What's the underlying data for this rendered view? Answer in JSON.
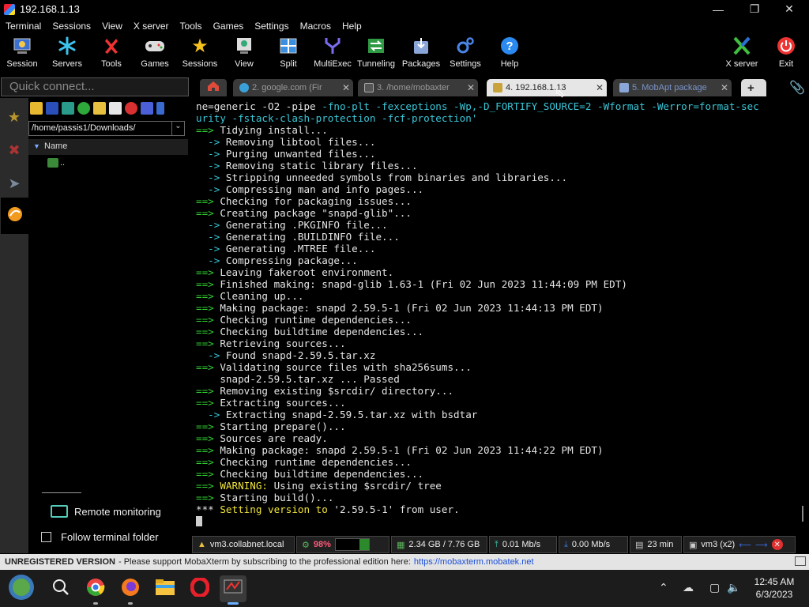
{
  "window": {
    "title": "192.168.1.13"
  },
  "menu": [
    "Terminal",
    "Sessions",
    "View",
    "X server",
    "Tools",
    "Games",
    "Settings",
    "Macros",
    "Help"
  ],
  "toolbar": {
    "session": "Session",
    "servers": "Servers",
    "tools": "Tools",
    "games": "Games",
    "sessions": "Sessions",
    "view": "View",
    "split": "Split",
    "multiexec": "MultiExec",
    "tunneling": "Tunneling",
    "packages": "Packages",
    "settings": "Settings",
    "help": "Help",
    "xserver": "X server",
    "exit": "Exit"
  },
  "quick_connect": {
    "placeholder": "Quick connect..."
  },
  "tabs": [
    {
      "label": "2. google.com (Fir",
      "active": false
    },
    {
      "label": "3. /home/mobaxter",
      "active": false
    },
    {
      "label": "4. 192.168.1.13",
      "active": true
    },
    {
      "label": "5. MobApt package",
      "active": false
    }
  ],
  "files": {
    "path": "/home/passis1/Downloads/",
    "column": "Name",
    "rows": [
      ".."
    ],
    "remote_monitoring": "Remote monitoring",
    "follow_folder": "Follow terminal folder"
  },
  "terminal": {
    "lines": [
      {
        "segs": [
          [
            "ne=generic -O2 -pipe ",
            "w"
          ],
          [
            "-fno-plt -fexceptions -Wp,-D_FORTIFY_SOURCE=2 -Wformat -Werror=format-sec",
            "c"
          ]
        ]
      },
      {
        "segs": [
          [
            "urity -fstack-clash-protection -fcf-protection'",
            "c"
          ]
        ]
      },
      {
        "segs": [
          [
            "==> ",
            "g"
          ],
          [
            "Tidying install...",
            "w"
          ]
        ]
      },
      {
        "segs": [
          [
            "  -> ",
            "c"
          ],
          [
            "Removing libtool files...",
            "w"
          ]
        ]
      },
      {
        "segs": [
          [
            "  -> ",
            "c"
          ],
          [
            "Purging unwanted files...",
            "w"
          ]
        ]
      },
      {
        "segs": [
          [
            "  -> ",
            "c"
          ],
          [
            "Removing static library files...",
            "w"
          ]
        ]
      },
      {
        "segs": [
          [
            "  -> ",
            "c"
          ],
          [
            "Stripping unneeded symbols from binaries and libraries...",
            "w"
          ]
        ]
      },
      {
        "segs": [
          [
            "  -> ",
            "c"
          ],
          [
            "Compressing man and info pages...",
            "w"
          ]
        ]
      },
      {
        "segs": [
          [
            "==> ",
            "g"
          ],
          [
            "Checking for packaging issues...",
            "w"
          ]
        ]
      },
      {
        "segs": [
          [
            "==> ",
            "g"
          ],
          [
            "Creating package \"snapd-glib\"...",
            "w"
          ]
        ]
      },
      {
        "segs": [
          [
            "  -> ",
            "c"
          ],
          [
            "Generating .PKGINFO file...",
            "w"
          ]
        ]
      },
      {
        "segs": [
          [
            "  -> ",
            "c"
          ],
          [
            "Generating .BUILDINFO file...",
            "w"
          ]
        ]
      },
      {
        "segs": [
          [
            "  -> ",
            "c"
          ],
          [
            "Generating .MTREE file...",
            "w"
          ]
        ]
      },
      {
        "segs": [
          [
            "  -> ",
            "c"
          ],
          [
            "Compressing package...",
            "w"
          ]
        ]
      },
      {
        "segs": [
          [
            "==> ",
            "g"
          ],
          [
            "Leaving fakeroot environment.",
            "w"
          ]
        ]
      },
      {
        "segs": [
          [
            "==> ",
            "g"
          ],
          [
            "Finished making: snapd-glib 1.63-1 (Fri 02 Jun 2023 11:44:09 PM EDT)",
            "w"
          ]
        ]
      },
      {
        "segs": [
          [
            "==> ",
            "g"
          ],
          [
            "Cleaning up...",
            "w"
          ]
        ]
      },
      {
        "segs": [
          [
            "==> ",
            "g"
          ],
          [
            "Making package: snapd 2.59.5-1 (Fri 02 Jun 2023 11:44:13 PM EDT)",
            "w"
          ]
        ]
      },
      {
        "segs": [
          [
            "==> ",
            "g"
          ],
          [
            "Checking runtime dependencies...",
            "w"
          ]
        ]
      },
      {
        "segs": [
          [
            "==> ",
            "g"
          ],
          [
            "Checking buildtime dependencies...",
            "w"
          ]
        ]
      },
      {
        "segs": [
          [
            "==> ",
            "g"
          ],
          [
            "Retrieving sources...",
            "w"
          ]
        ]
      },
      {
        "segs": [
          [
            "  -> ",
            "c"
          ],
          [
            "Found snapd-2.59.5.tar.xz",
            "w"
          ]
        ]
      },
      {
        "segs": [
          [
            "==> ",
            "g"
          ],
          [
            "Validating source files with sha256sums...",
            "w"
          ]
        ]
      },
      {
        "segs": [
          [
            "    snapd-2.59.5.tar.xz ... Passed",
            "w"
          ]
        ]
      },
      {
        "segs": [
          [
            "==> ",
            "g"
          ],
          [
            "Removing existing $srcdir/ directory...",
            "w"
          ]
        ]
      },
      {
        "segs": [
          [
            "==> ",
            "g"
          ],
          [
            "Extracting sources...",
            "w"
          ]
        ]
      },
      {
        "segs": [
          [
            "  -> ",
            "c"
          ],
          [
            "Extracting snapd-2.59.5.tar.xz with bsdtar",
            "w"
          ]
        ]
      },
      {
        "segs": [
          [
            "==> ",
            "g"
          ],
          [
            "Starting prepare()...",
            "w"
          ]
        ]
      },
      {
        "segs": [
          [
            "==> ",
            "g"
          ],
          [
            "Sources are ready.",
            "w"
          ]
        ]
      },
      {
        "segs": [
          [
            "==> ",
            "g"
          ],
          [
            "Making package: snapd 2.59.5-1 (Fri 02 Jun 2023 11:44:22 PM EDT)",
            "w"
          ]
        ]
      },
      {
        "segs": [
          [
            "==> ",
            "g"
          ],
          [
            "Checking runtime dependencies...",
            "w"
          ]
        ]
      },
      {
        "segs": [
          [
            "==> ",
            "g"
          ],
          [
            "Checking buildtime dependencies...",
            "w"
          ]
        ]
      },
      {
        "segs": [
          [
            "==> ",
            "g"
          ],
          [
            "WARNING: ",
            "y"
          ],
          [
            "Using existing $srcdir/ tree",
            "w"
          ]
        ]
      },
      {
        "segs": [
          [
            "==> ",
            "g"
          ],
          [
            "Starting build()...",
            "w"
          ]
        ]
      },
      {
        "segs": [
          [
            "*** ",
            "w"
          ],
          [
            "Setting version to ",
            "y"
          ],
          [
            "'2.59.5-1'",
            "w"
          ],
          [
            " from user.",
            "w"
          ]
        ]
      }
    ]
  },
  "statusbar": {
    "host": "vm3.collabnet.local",
    "cpu": "98%",
    "memory": "2.34 GB / 7.76 GB",
    "upload": "0.01 Mb/s",
    "download": "0.00 Mb/s",
    "uptime": "23 min",
    "user": "vm3 (x2)"
  },
  "unregistered": {
    "label": "UNREGISTERED VERSION",
    "message": "-  Please support MobaXterm by subscribing to the professional edition here:",
    "link": "https://mobaxterm.mobatek.net"
  },
  "taskbar": {
    "time": "12:45 AM",
    "date": "6/3/2023"
  },
  "colors": {
    "green": "#33d133",
    "cyan": "#39c7d8",
    "yellow": "#f0e33a"
  }
}
